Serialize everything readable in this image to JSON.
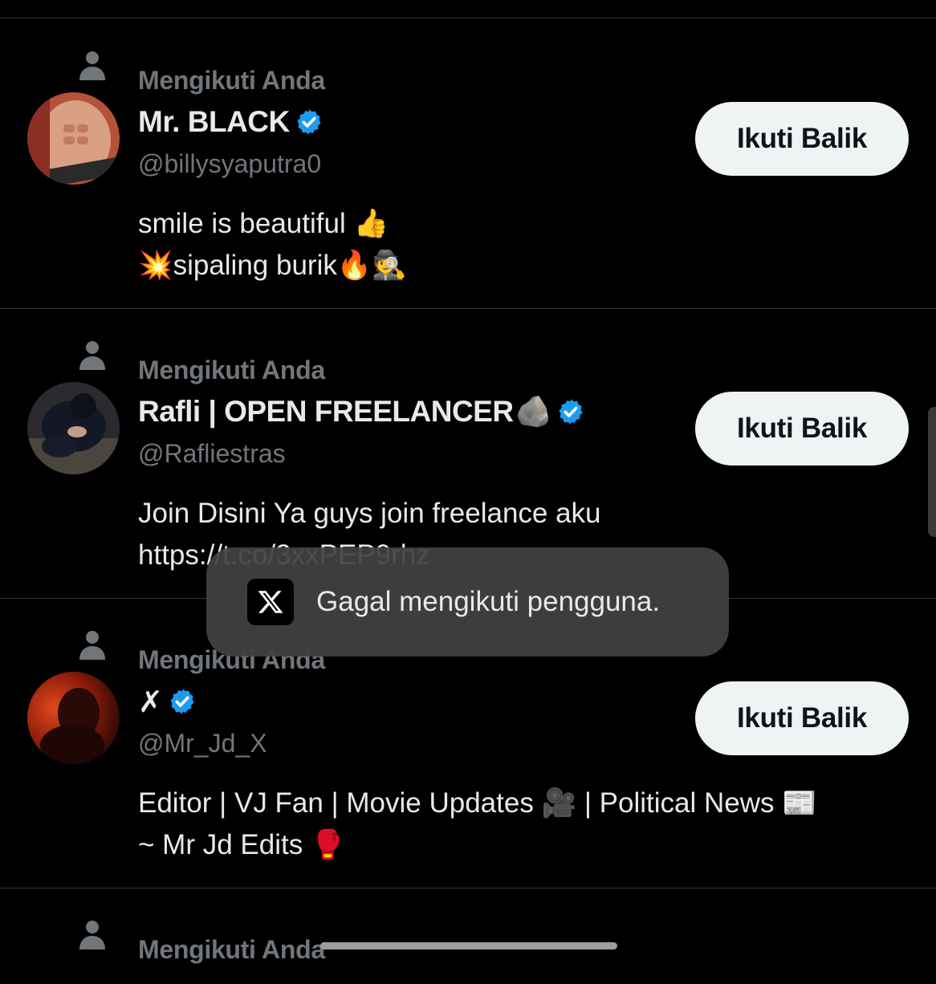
{
  "list": [
    {
      "follows_label": "Mengikuti Anda",
      "name": "Mr. BLACK",
      "name_emoji": "",
      "verified": true,
      "handle": "@billysyaputra0",
      "bio": "smile is beautiful 👍\n💥sipaling burik🔥🕵️",
      "button_label": "Ikuti Balik"
    },
    {
      "follows_label": "Mengikuti Anda",
      "name": "Rafli | OPEN FREELANCER",
      "name_emoji": "🪨",
      "verified": true,
      "handle": "@Rafliestras",
      "bio": "Join Disini Ya guys join freelance aku\nhttps://t.co/3xxPEP9rhz",
      "button_label": "Ikuti Balik"
    },
    {
      "follows_label": "Mengikuti Anda",
      "name": "✗",
      "name_emoji": "",
      "verified": true,
      "handle": "@Mr_Jd_X",
      "bio": "Editor | VJ Fan | Movie Updates 🎥 | Political News 📰\n   ~ Mr Jd Edits 🥊",
      "button_label": "Ikuti Balik"
    },
    {
      "follows_label": "Mengikuti Anda"
    }
  ],
  "toast": {
    "message": "Gagal mengikuti pengguna.",
    "icon": "x-logo-icon"
  },
  "colors": {
    "background": "#000000",
    "verified": "#1d9bf0",
    "muted_text": "#71767b",
    "button_bg": "#eff3f4"
  }
}
